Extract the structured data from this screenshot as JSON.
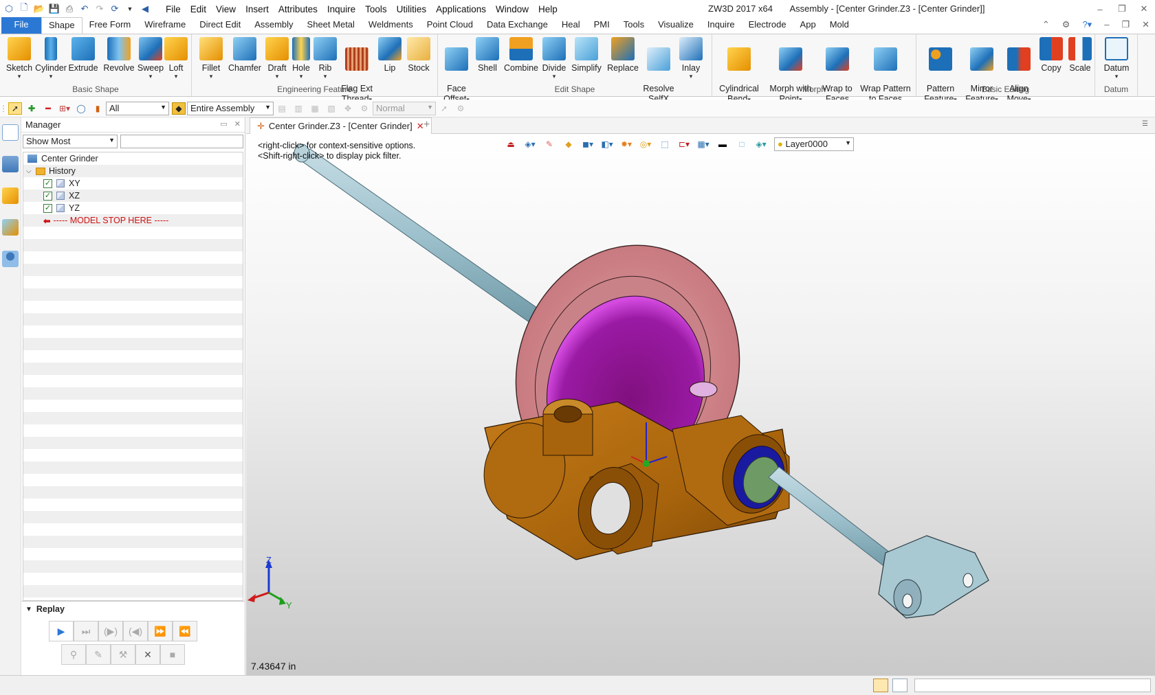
{
  "menubar": {
    "items": [
      "File",
      "Edit",
      "View",
      "Insert",
      "Attributes",
      "Inquire",
      "Tools",
      "Utilities",
      "Applications",
      "Window",
      "Help"
    ]
  },
  "titlebar": {
    "app": "ZW3D 2017  x64",
    "document": "Assembly - [Center Grinder.Z3 - [Center Grinder]]"
  },
  "ribbon_tabs": [
    "File",
    "Shape",
    "Free Form",
    "Wireframe",
    "Direct Edit",
    "Assembly",
    "Sheet Metal",
    "Weldments",
    "Point Cloud",
    "Data Exchange",
    "Heal",
    "PMI",
    "Tools",
    "Visualize",
    "Inquire",
    "Electrode",
    "App",
    "Mold"
  ],
  "ribbon": {
    "basic_shape": {
      "label": "Basic Shape",
      "tools": [
        "Sketch",
        "Cylinder",
        "Extrude",
        "Revolve",
        "Sweep",
        "Loft"
      ]
    },
    "engineering_feature": {
      "label": "Engineering Feature",
      "tools": [
        "Fillet",
        "Chamfer",
        "Draft",
        "Hole",
        "Rib",
        "Flag Ext\nThread",
        "Lip",
        "Stock"
      ]
    },
    "edit_shape": {
      "label": "Edit Shape",
      "tools": [
        "Face\nOffset",
        "Shell",
        "Combine",
        "Divide",
        "Simplify",
        "Replace",
        "Resolve\nSelfX",
        "Inlay"
      ]
    },
    "morph": {
      "label": "Morph",
      "tools": [
        "Cylindrical\nBend",
        "Morph with\nPoint",
        "Wrap to\nFaces",
        "Wrap Pattern\nto Faces"
      ]
    },
    "basic_editing": {
      "label": "Basic Editing",
      "tools": [
        "Pattern\nFeature",
        "Mirror\nFeature",
        "Align\nMove",
        "Copy",
        "Scale"
      ]
    },
    "datum": {
      "label": "Datum",
      "tools": [
        "Datum"
      ]
    }
  },
  "toolbar": {
    "filter_value": "All",
    "scope_value": "Entire Assembly",
    "mode_value": "Normal"
  },
  "manager": {
    "title": "Manager",
    "show_filter": "Show Most",
    "tree": {
      "root": "Center Grinder",
      "history": "History",
      "planes": [
        "XY",
        "XZ",
        "YZ"
      ],
      "stop": "----- MODEL STOP HERE -----"
    },
    "replay_label": "Replay"
  },
  "document_tab": {
    "label": "Center Grinder.Z3 - [Center Grinder]"
  },
  "viewport": {
    "hint1": "<right-click> for context-sensitive options.",
    "hint2": "<Shift-right-click> to display pick filter.",
    "layer": "Layer0000",
    "measurement": "7.43647 in",
    "triad": {
      "x": "X",
      "y": "Y",
      "z": "Z"
    }
  },
  "colors": {
    "file_tab": "#2b78d4",
    "body_orange": "#b06a10",
    "wheel_pink": "#d8898e",
    "wheel_magenta": "#b018c0",
    "shaft_blue": "#9cc0cc"
  }
}
